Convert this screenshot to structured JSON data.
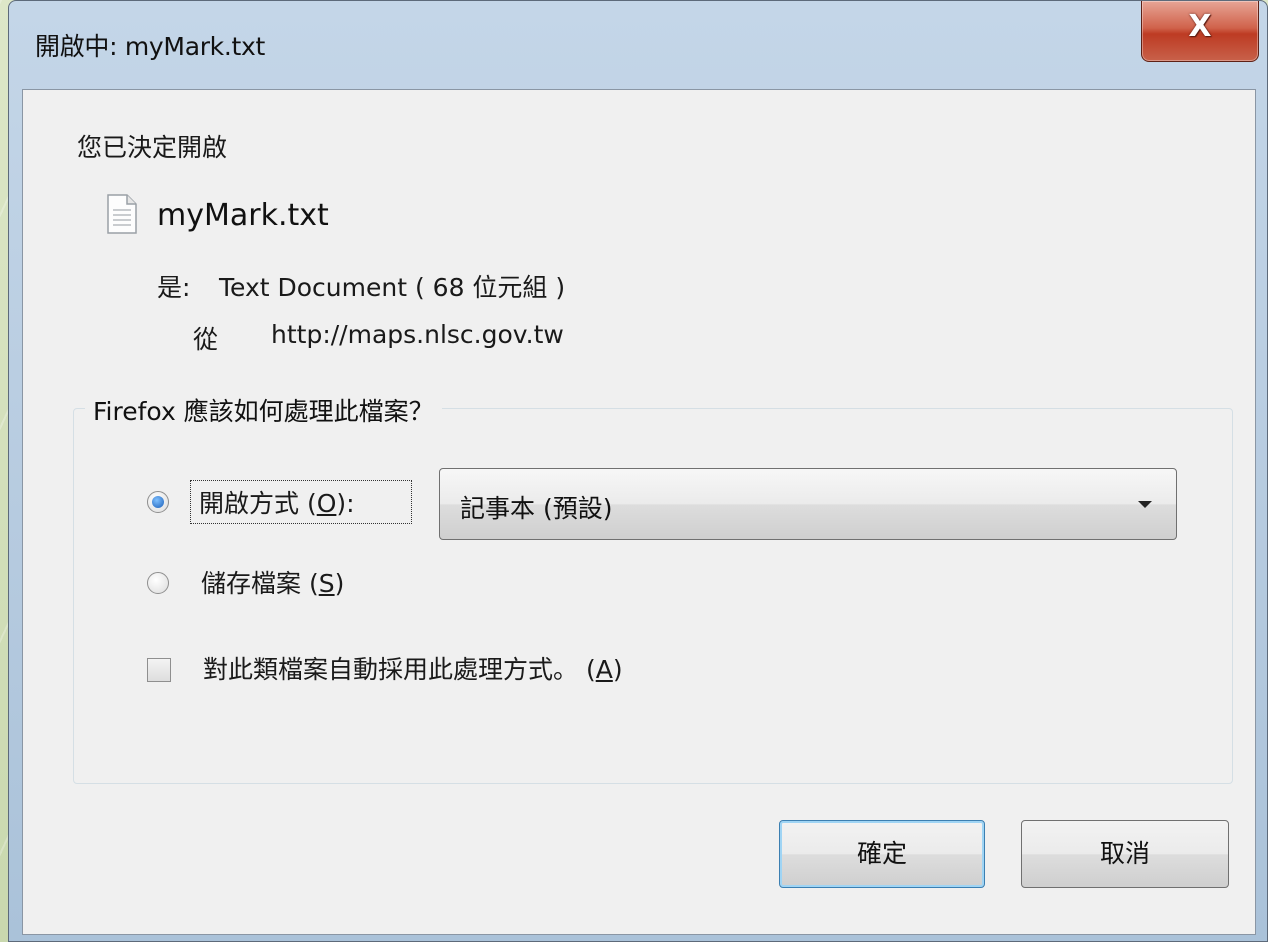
{
  "window": {
    "title": "開啟中: myMark.txt",
    "close_label": "X"
  },
  "dialog": {
    "decided_text": "您已決定開啟",
    "file_icon": "text-file-icon",
    "file_name": "myMark.txt",
    "type_label": "是:",
    "type_value": "Text Document ( 68 位元組 )",
    "from_label": "從",
    "from_value": "http://maps.nlsc.gov.tw"
  },
  "action_group": {
    "legend": "Firefox 應該如何處理此檔案？",
    "open_with": {
      "label": "開啟方式 (",
      "accel": "O",
      "label_end": "):",
      "checked": true,
      "selected_app": "記事本 (預設)"
    },
    "save_file": {
      "label": "儲存檔案 (",
      "accel": "S",
      "label_end": ")",
      "checked": false
    },
    "auto_apply": {
      "label": "對此類檔案自動採用此處理方式。 (",
      "accel": "A",
      "label_end": ")",
      "checked": false
    }
  },
  "buttons": {
    "ok": "確定",
    "cancel": "取消"
  },
  "colors": {
    "titlebar": "#b5cadf",
    "close_button": "#c8493a",
    "client_bg": "#f0f0f0",
    "default_button_border": "#3c7fb1"
  }
}
